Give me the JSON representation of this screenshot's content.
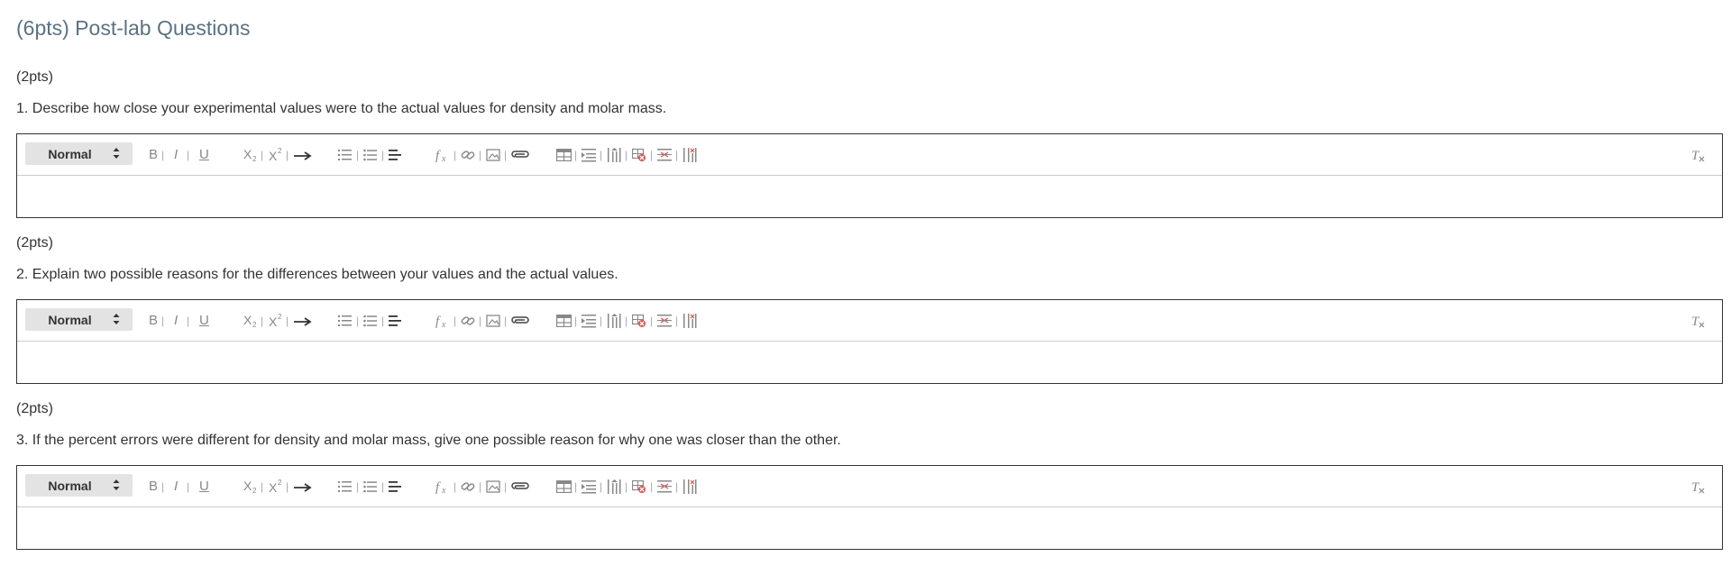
{
  "section": {
    "title": "(6pts) Post-lab Questions"
  },
  "questions": [
    {
      "points": "(2pts)",
      "text": "1. Describe how close your experimental values were to the actual values for density and molar mass.",
      "format_select": "Normal"
    },
    {
      "points": "(2pts)",
      "text": "2. Explain two possible reasons for the differences between your values and the actual values.",
      "format_select": "Normal"
    },
    {
      "points": "(2pts)",
      "text": "3. If the percent errors were different for density and molar mass, give one possible reason for why one was closer than the other.",
      "format_select": "Normal"
    }
  ],
  "toolbar_icons": [
    "bold-icon",
    "italic-icon",
    "underline-icon",
    "subscript-icon",
    "superscript-icon",
    "arrow-icon",
    "ordered-list-icon",
    "bullet-list-icon",
    "align-left-icon",
    "formula-icon",
    "link-icon",
    "image-icon",
    "attachment-icon",
    "table-icon",
    "insert-row-icon",
    "insert-column-icon",
    "delete-table-icon",
    "delete-row-icon",
    "delete-column-icon",
    "clear-format-icon"
  ],
  "colors": {
    "title": "#5a7282",
    "border": "#333333",
    "select_bg": "#e3e3e3",
    "icon": "#888888",
    "accent_red": "#d9534f"
  }
}
